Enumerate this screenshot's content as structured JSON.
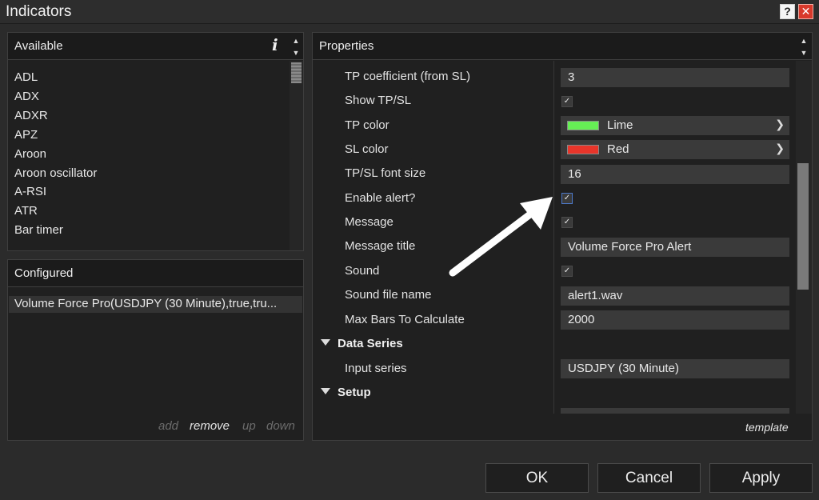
{
  "window": {
    "title": "Indicators",
    "help_label": "?",
    "close_label": "✕"
  },
  "available": {
    "title": "Available",
    "info_label": "i",
    "items": [
      "ADL",
      "ADX",
      "ADXR",
      "APZ",
      "Aroon",
      "Aroon oscillator",
      "A-RSI",
      "ATR",
      "Bar timer"
    ]
  },
  "configured": {
    "title": "Configured",
    "items": [
      "Volume Force Pro(USDJPY (30 Minute),true,tru..."
    ],
    "actions": {
      "add": "add",
      "remove": "remove",
      "up": "up",
      "down": "down"
    }
  },
  "properties": {
    "title": "Properties",
    "rows": {
      "tp_coef": {
        "label": "TP coefficient (from SL)",
        "value": "3"
      },
      "show_tpsl": {
        "label": "Show TP/SL"
      },
      "tp_color": {
        "label": "TP color",
        "value": "Lime",
        "swatch": "#66ee55"
      },
      "sl_color": {
        "label": "SL color",
        "value": "Red",
        "swatch": "#e8352a"
      },
      "font_size": {
        "label": "TP/SL font size",
        "value": "16"
      },
      "enable_alert": {
        "label": "Enable alert?"
      },
      "message": {
        "label": "Message"
      },
      "message_title": {
        "label": "Message title",
        "value": "Volume Force Pro Alert"
      },
      "sound": {
        "label": "Sound"
      },
      "sound_file": {
        "label": "Sound file name",
        "value": "alert1.wav"
      },
      "max_bars": {
        "label": "Max Bars To Calculate",
        "value": "2000"
      },
      "input_series": {
        "label": "Input series",
        "value": "USDJPY (30 Minute)"
      }
    },
    "categories": {
      "data_series": "Data Series",
      "setup": "Setup"
    },
    "template_label": "template"
  },
  "buttons": {
    "ok": "OK",
    "cancel": "Cancel",
    "apply": "Apply"
  },
  "colors": {
    "accent": "#4c78c8",
    "arrow": "#ffffff"
  }
}
